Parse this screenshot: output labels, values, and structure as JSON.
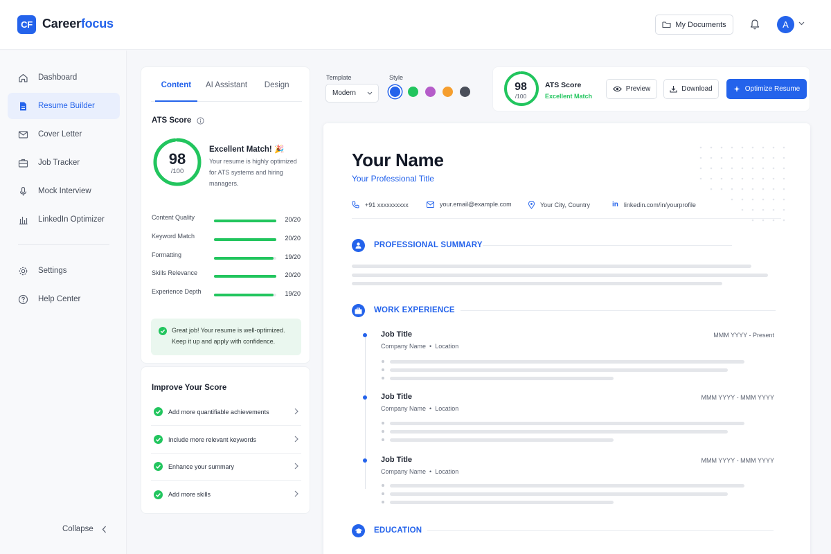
{
  "app": {
    "logo_mark": "CF",
    "name_part1": "Career",
    "name_part2": "focus",
    "brand_color": "#2463eb"
  },
  "header": {
    "documents_button": "My Documents",
    "avatar_initial": "A"
  },
  "sidebar": {
    "items": [
      {
        "label": "Dashboard",
        "icon": "home-icon"
      },
      {
        "label": "Resume Builder",
        "icon": "document-icon",
        "active": true
      },
      {
        "label": "Cover Letter",
        "icon": "mail-icon"
      },
      {
        "label": "Job Tracker",
        "icon": "briefcase-icon"
      },
      {
        "label": "Mock Interview",
        "icon": "microphone-icon"
      },
      {
        "label": "LinkedIn Optimizer",
        "icon": "bar-chart-icon"
      }
    ],
    "secondary": [
      {
        "label": "Settings",
        "icon": "gear-icon"
      },
      {
        "label": "Help Center",
        "icon": "help-icon"
      }
    ],
    "collapse_label": "Collapse"
  },
  "panel": {
    "tabs": [
      "Content",
      "AI Assistant",
      "Design"
    ],
    "active_tab": "Content",
    "ats_title": "ATS Score",
    "score": "98",
    "score_max": "/100",
    "score_fraction": 0.98,
    "match_title": "Excellent Match! 🎉",
    "match_desc": "Your resume is highly optimized for ATS systems and hiring managers.",
    "metrics": [
      {
        "label": "Content Quality",
        "value": "20/20",
        "fraction": 1.0
      },
      {
        "label": "Keyword Match",
        "value": "20/20",
        "fraction": 1.0
      },
      {
        "label": "Formatting",
        "value": "19/20",
        "fraction": 0.95
      },
      {
        "label": "Skills Relevance",
        "value": "20/20",
        "fraction": 1.0
      },
      {
        "label": "Experience Depth",
        "value": "19/20",
        "fraction": 0.95
      }
    ],
    "success_message": "Great job! Your resume is well-optimized. Keep it up and apply with confidence."
  },
  "improve": {
    "title": "Improve Your Score",
    "items": [
      "Add more quantifiable achievements",
      "Include more relevant keywords",
      "Enhance your summary",
      "Add more skills"
    ]
  },
  "toolbar": {
    "template_label": "Template",
    "template_value": "Modern",
    "style_label": "Style",
    "style_colors": [
      "#2463eb",
      "#22c55e",
      "#b55cc9",
      "#f59e2e",
      "#4a4f5a"
    ],
    "selected_style": 0,
    "ats_score": "98",
    "ats_max": "/100",
    "ats_title": "ATS Score",
    "ats_status": "Excellent Match",
    "preview_label": "Preview",
    "download_label": "Download",
    "optimize_label": "Optimize Resume"
  },
  "resume": {
    "name": "Your Name",
    "title": "Your Professional Title",
    "phone": "+91 xxxxxxxxxx",
    "email": "your.email@example.com",
    "location": "Your City, Country",
    "linkedin": "linkedin.com/in/yourprofile",
    "sections": {
      "summary": "PROFESSIONAL SUMMARY",
      "experience": "WORK EXPERIENCE",
      "education": "EDUCATION"
    },
    "jobs": [
      {
        "title": "Job Title",
        "company": "Company Name",
        "location": "Location",
        "dates": "MMM YYYY - Present"
      },
      {
        "title": "Job Title",
        "company": "Company Name",
        "location": "Location",
        "dates": "MMM YYYY - MMM YYYY"
      },
      {
        "title": "Job Title",
        "company": "Company Name",
        "location": "Location",
        "dates": "MMM YYYY - MMM YYYY"
      }
    ]
  }
}
